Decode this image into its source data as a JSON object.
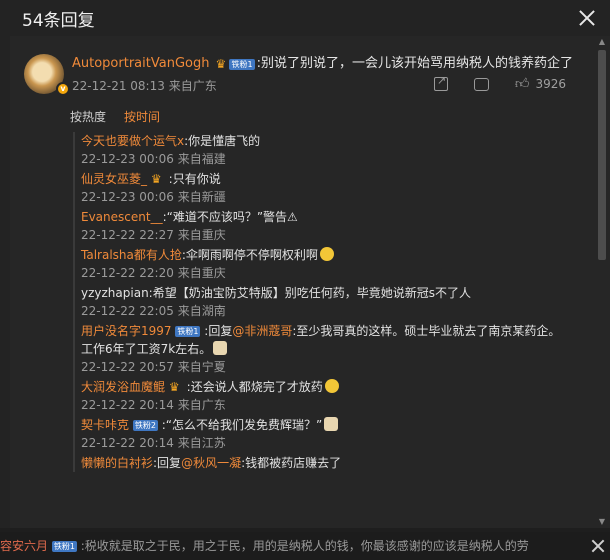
{
  "modal": {
    "title": "54条回复"
  },
  "main_comment": {
    "username": "AutoportraitVanGogh",
    "badge": "铁粉1",
    "text": ":别说了别说了，一会儿该开始骂用纳税人的钱养药企了",
    "time": "22-12-21 08:13",
    "location": "来自广东",
    "likes": "3926"
  },
  "sort": {
    "by_heat": "按热度",
    "by_time": "按时间"
  },
  "replies": [
    {
      "name": "今天也要做个运气x",
      "text": ":你是懂唐飞的",
      "time": "22-12-23 00:06",
      "location": "来自福建"
    },
    {
      "name": "仙灵女巫菱_",
      "text": ":只有你说",
      "time": "22-12-23 00:06",
      "location": "来自新疆"
    },
    {
      "name": "Evanescent__",
      "text": ":“难道不应该吗？”警告⚠",
      "time": "22-12-22 22:27",
      "location": "来自重庆"
    },
    {
      "name": "Talralsha都有人抢",
      "text": ":伞啊雨啊停不停啊权利啊",
      "time": "22-12-22 22:20",
      "location": "来自重庆"
    },
    {
      "name": "yzyzhapian",
      "text": ":希望【奶油宝防艾特版】别吃任何药，毕竟她说新冠s不了人",
      "time": "22-12-22 22:05",
      "location": "来自湖南"
    },
    {
      "name": "用户没名字1997",
      "badge": "铁粉1",
      "text_prefix": ":回复",
      "mention": "@非洲蔻哥",
      "text": ":至少我哥真的这样。硕士毕业就去了南京某药企。",
      "text2": "工作6年了工资7k左右。",
      "time": "22-12-22 20:57",
      "location": "来自宁夏"
    },
    {
      "name": "大润发浴血魔鲲",
      "text": ":还会说人都烧完了才放药",
      "time": "22-12-22 20:14",
      "location": "来自广东"
    },
    {
      "name": "契卡咔克",
      "badge": "铁粉2",
      "text": ":“怎么不给我们发免费辉瑞？”",
      "time": "22-12-22 20:14",
      "location": "来自江苏"
    },
    {
      "name": "懒懒的白衬衫",
      "text_prefix": ":回复",
      "mention": "@秋风一凝",
      "text": ":钱都被药店赚去了",
      "time": "",
      "location": ""
    }
  ],
  "bottom_bar": {
    "name": "容安六月",
    "badge": "铁粉1",
    "text": ":税收就是取之于民，用之于民，用的是纳税人的钱，你最该感谢的应该是纳税人的劳"
  }
}
